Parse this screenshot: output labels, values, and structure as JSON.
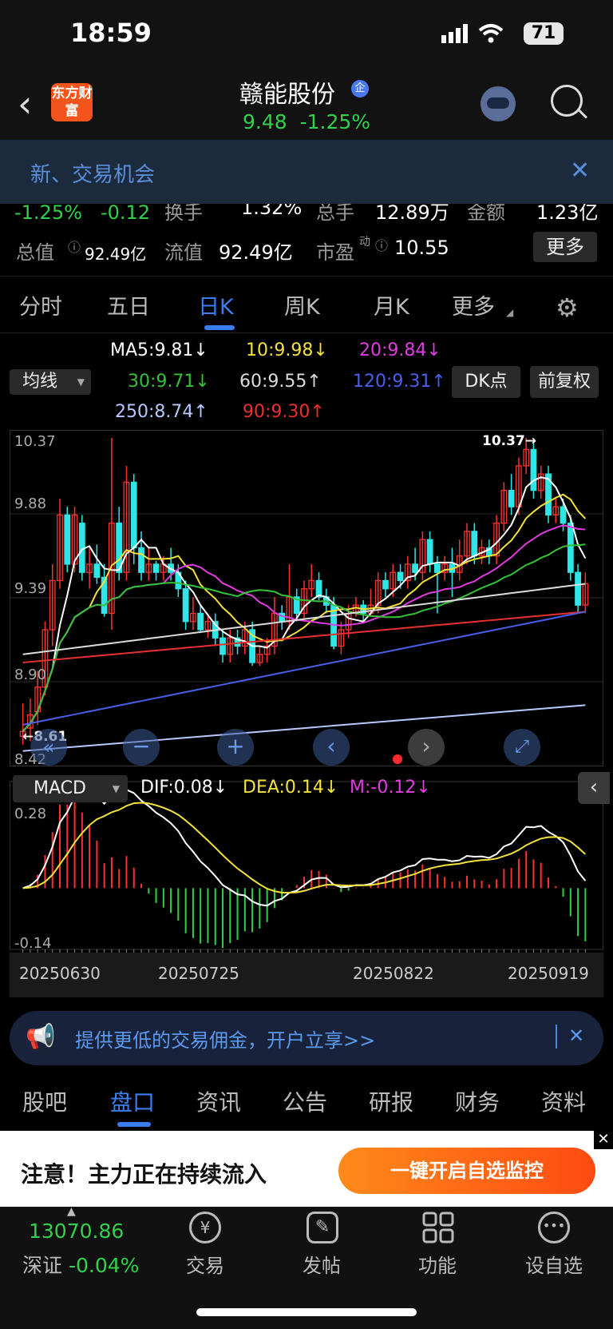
{
  "status_bar": {
    "time": "18:59",
    "battery": "71"
  },
  "header": {
    "logo_text": "东方财富",
    "stock_name": "赣能股份",
    "badge": "企",
    "price": "9.48",
    "change_pct": "-1.25%"
  },
  "banner": {
    "text": "新、交易机会"
  },
  "quote": {
    "row1": [
      "-1.25%",
      "-0.12",
      "换手",
      "1.32%",
      "总手",
      "12.89万",
      "金额",
      "1.23亿"
    ],
    "row2": {
      "total_value_label": "总值",
      "total_value": "92.49亿",
      "float_value_label": "流值",
      "float_value": "92.49亿",
      "pe_label": "市盈",
      "pe_sup": "动",
      "pe_value": "10.55",
      "more_button": "更多"
    }
  },
  "ktabs": [
    "分时",
    "五日",
    "日K",
    "周K",
    "月K",
    "更多"
  ],
  "ktabs_active": "日K",
  "ma_legend": {
    "indicator_select": "均线",
    "items": [
      {
        "text": "MA5:9.81↓",
        "color": "#ffffff"
      },
      {
        "text": "10:9.98↓",
        "color": "#f2e23a"
      },
      {
        "text": "20:9.84↓",
        "color": "#e03ce0"
      },
      {
        "text": "30:9.71↓",
        "color": "#35c23a"
      },
      {
        "text": "60:9.55↑",
        "color": "#dddddd"
      },
      {
        "text": "120:9.31↑",
        "color": "#4a5fe8"
      },
      {
        "text": "250:8.74↑",
        "color": "#b9c8ff"
      },
      {
        "text": "90:9.30↑",
        "color": "#e83030"
      }
    ],
    "dk_button": "DK点",
    "fq_button": "前复权"
  },
  "price_axis": [
    "10.37",
    "9.88",
    "9.39",
    "8.90",
    "8.42"
  ],
  "price_markers": {
    "high": "10.37",
    "low": "8.61"
  },
  "macd_legend": {
    "select": "MACD",
    "dif": "DIF:0.08↓",
    "dea": "DEA:0.14↓",
    "m": "M:-0.12↓"
  },
  "macd_axis": {
    "top": "0.28",
    "bottom": "-0.14"
  },
  "date_axis": [
    "20250630",
    "20250725",
    "20250822",
    "20250919"
  ],
  "chart_data": {
    "type": "candlestick",
    "ylim": [
      8.42,
      10.37
    ],
    "candles": [
      [
        8.55,
        8.58,
        8.5,
        8.75
      ],
      [
        8.6,
        8.68,
        8.52,
        8.78
      ],
      [
        8.7,
        8.85,
        8.62,
        8.95
      ],
      [
        8.85,
        9.2,
        8.8,
        9.25
      ],
      [
        9.2,
        9.5,
        9.1,
        9.6
      ],
      [
        9.5,
        9.9,
        9.45,
        10.0
      ],
      [
        9.9,
        9.6,
        9.55,
        9.95
      ],
      [
        9.6,
        9.9,
        9.55,
        9.95
      ],
      [
        9.85,
        9.55,
        9.5,
        9.9
      ],
      [
        9.55,
        9.6,
        9.45,
        9.7
      ],
      [
        9.6,
        9.52,
        9.48,
        9.72
      ],
      [
        9.52,
        9.3,
        9.28,
        9.6
      ],
      [
        9.3,
        9.85,
        9.2,
        10.37
      ],
      [
        9.85,
        9.55,
        9.5,
        9.95
      ],
      [
        9.55,
        10.1,
        9.5,
        10.2
      ],
      [
        10.1,
        9.7,
        9.6,
        10.15
      ],
      [
        9.7,
        9.55,
        9.5,
        9.8
      ],
      [
        9.55,
        9.6,
        9.5,
        9.7
      ],
      [
        9.6,
        9.55,
        9.5,
        9.62
      ],
      [
        9.55,
        9.6,
        9.5,
        9.65
      ],
      [
        9.6,
        9.55,
        9.5,
        9.7
      ],
      [
        9.55,
        9.45,
        9.4,
        9.6
      ],
      [
        9.45,
        9.25,
        9.2,
        9.5
      ],
      [
        9.25,
        9.3,
        9.2,
        9.4
      ],
      [
        9.3,
        9.2,
        9.18,
        9.35
      ],
      [
        9.2,
        9.25,
        9.15,
        9.3
      ],
      [
        9.25,
        9.15,
        9.1,
        9.3
      ],
      [
        9.15,
        9.05,
        9.0,
        9.2
      ],
      [
        9.05,
        9.15,
        9.0,
        9.2
      ],
      [
        9.15,
        9.1,
        9.05,
        9.2
      ],
      [
        9.1,
        9.2,
        9.05,
        9.25
      ],
      [
        9.2,
        9.0,
        8.98,
        9.25
      ],
      [
        9.0,
        9.05,
        8.98,
        9.1
      ],
      [
        9.05,
        9.1,
        9.0,
        9.15
      ],
      [
        9.1,
        9.3,
        9.05,
        9.4
      ],
      [
        9.3,
        9.25,
        9.2,
        9.35
      ],
      [
        9.25,
        9.4,
        9.2,
        9.6
      ],
      [
        9.4,
        9.3,
        9.25,
        9.45
      ],
      [
        9.3,
        9.45,
        9.25,
        9.5
      ],
      [
        9.45,
        9.5,
        9.4,
        9.6
      ],
      [
        9.5,
        9.4,
        9.38,
        9.55
      ],
      [
        9.4,
        9.35,
        9.3,
        9.45
      ],
      [
        9.35,
        9.1,
        9.08,
        9.4
      ],
      [
        9.1,
        9.2,
        9.05,
        9.25
      ],
      [
        9.2,
        9.3,
        9.15,
        9.35
      ],
      [
        9.3,
        9.35,
        9.28,
        9.4
      ],
      [
        9.35,
        9.3,
        9.25,
        9.38
      ],
      [
        9.3,
        9.35,
        9.28,
        9.45
      ],
      [
        9.35,
        9.5,
        9.3,
        9.55
      ],
      [
        9.5,
        9.45,
        9.4,
        9.55
      ],
      [
        9.45,
        9.55,
        9.4,
        9.6
      ],
      [
        9.55,
        9.5,
        9.45,
        9.6
      ],
      [
        9.5,
        9.6,
        9.45,
        9.65
      ],
      [
        9.6,
        9.55,
        9.5,
        9.7
      ],
      [
        9.55,
        9.75,
        9.5,
        9.8
      ],
      [
        9.75,
        9.6,
        9.55,
        9.8
      ],
      [
        9.6,
        9.55,
        9.3,
        9.65
      ],
      [
        9.55,
        9.6,
        9.5,
        9.65
      ],
      [
        9.6,
        9.55,
        9.4,
        9.7
      ],
      [
        9.55,
        9.65,
        9.5,
        9.75
      ],
      [
        9.65,
        9.8,
        9.6,
        9.85
      ],
      [
        9.8,
        9.65,
        9.6,
        9.85
      ],
      [
        9.65,
        9.7,
        9.6,
        9.75
      ],
      [
        9.7,
        9.65,
        9.6,
        9.75
      ],
      [
        9.65,
        9.85,
        9.6,
        9.9
      ],
      [
        9.85,
        10.05,
        9.8,
        10.1
      ],
      [
        10.05,
        9.95,
        9.9,
        10.15
      ],
      [
        9.95,
        10.2,
        9.9,
        10.25
      ],
      [
        10.2,
        10.3,
        10.15,
        10.37
      ],
      [
        10.3,
        10.05,
        10.0,
        10.35
      ],
      [
        10.05,
        10.15,
        10.0,
        10.2
      ],
      [
        10.15,
        9.9,
        9.85,
        10.2
      ],
      [
        9.9,
        9.95,
        9.85,
        10.0
      ],
      [
        9.95,
        9.85,
        9.8,
        10.0
      ],
      [
        9.85,
        9.55,
        9.5,
        9.9
      ],
      [
        9.55,
        9.35,
        9.3,
        9.6
      ],
      [
        9.35,
        9.48,
        9.3,
        9.55
      ]
    ]
  },
  "ad": {
    "text": "提供更低的交易佣金，开户立享>>"
  },
  "btabs": [
    "股吧",
    "盘口",
    "资讯",
    "公告",
    "研报",
    "财务",
    "资料"
  ],
  "btabs_active": "盘口",
  "promo": {
    "text": "注意！主力正在持续流入",
    "button": "一键开启自选监控"
  },
  "nav": {
    "index_value": "13070.86",
    "index_name": "深证",
    "index_change": "-0.04%",
    "items": [
      "交易",
      "发帖",
      "功能",
      "设自选"
    ]
  }
}
